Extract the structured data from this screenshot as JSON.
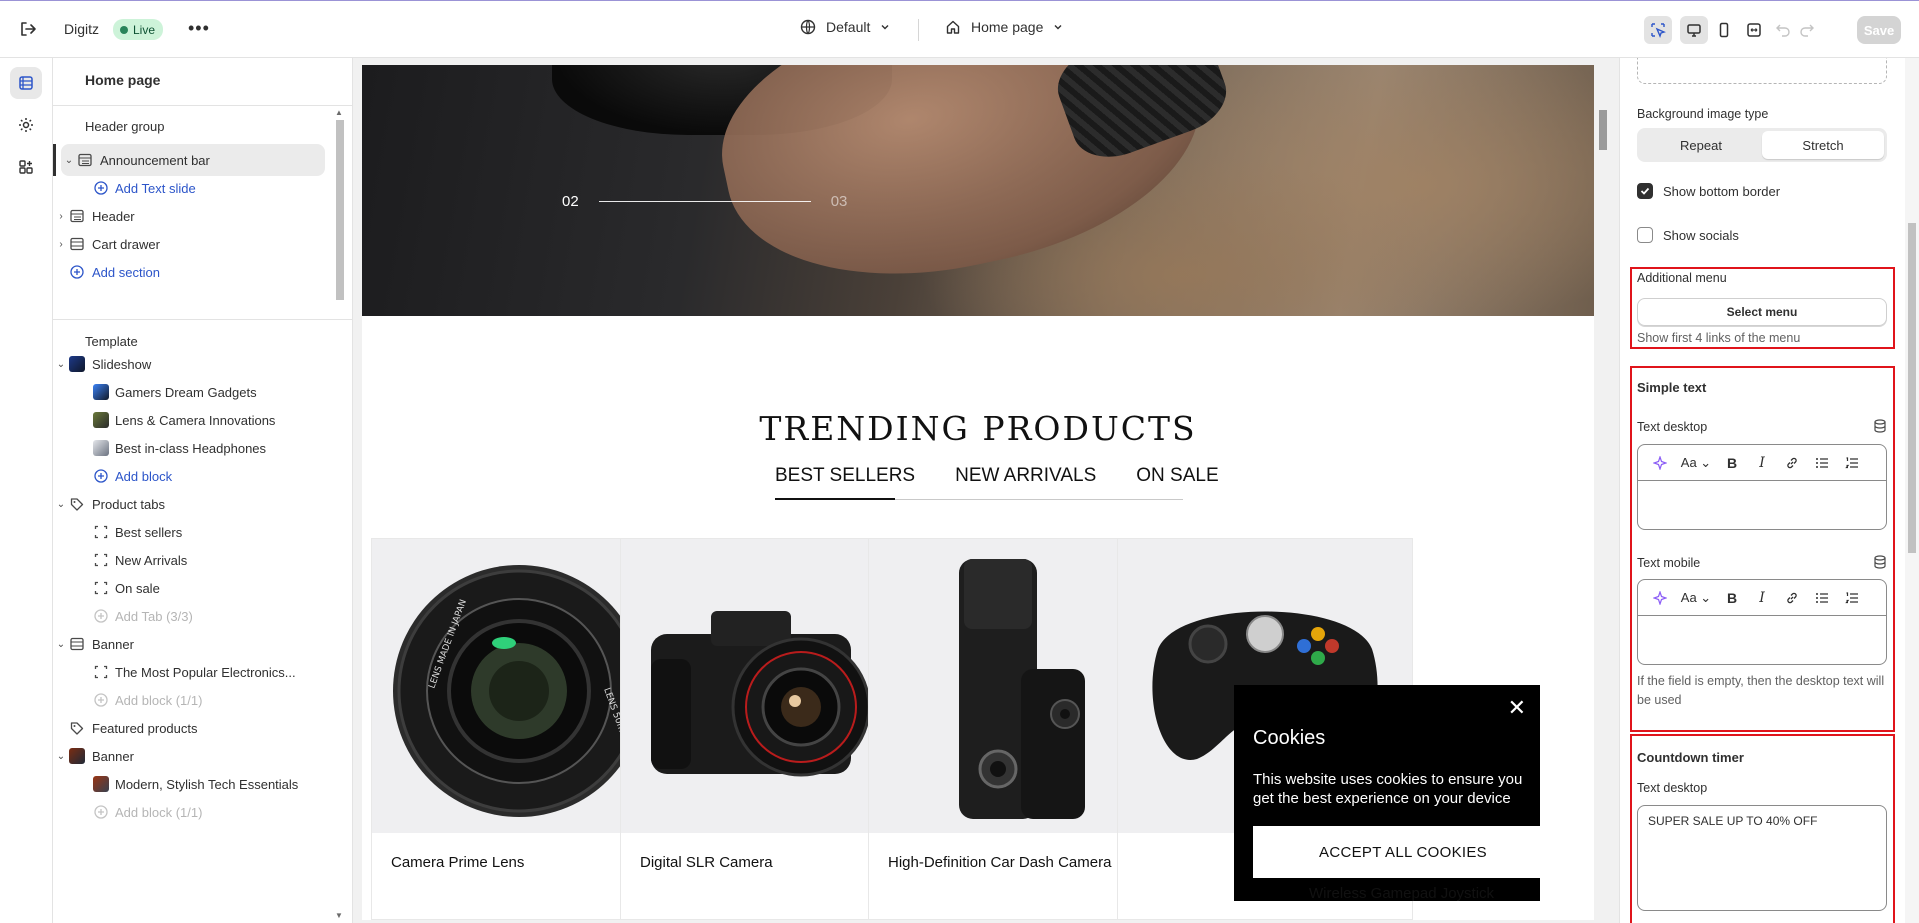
{
  "topbar": {
    "store_name": "Digitz",
    "status": "Live",
    "theme_select": "Default",
    "page_select": "Home page",
    "save_label": "Save"
  },
  "sidebar": {
    "title": "Home page",
    "header_group_label": "Header group",
    "header_items": [
      {
        "label": "Announcement bar",
        "icon": "section-icon",
        "selected": true
      },
      {
        "label": "Add Text slide",
        "type": "add"
      },
      {
        "label": "Header",
        "icon": "section-icon"
      },
      {
        "label": "Cart drawer",
        "icon": "section-icon"
      },
      {
        "label": "Add section",
        "type": "add"
      }
    ],
    "template_label": "Template",
    "template_items": [
      {
        "label": "Slideshow",
        "icon": "slideshow-thumb"
      },
      {
        "label": "Gamers Dream Gadgets",
        "icon": "image-thumb"
      },
      {
        "label": "Lens & Camera Innovations",
        "icon": "image-thumb"
      },
      {
        "label": "Best in-class Headphones",
        "icon": "image-thumb"
      },
      {
        "label": "Add block",
        "type": "add"
      },
      {
        "label": "Product tabs",
        "icon": "tag-icon"
      },
      {
        "label": "Best sellers",
        "icon": "block-icon"
      },
      {
        "label": "New Arrivals",
        "icon": "block-icon"
      },
      {
        "label": "On sale",
        "icon": "block-icon"
      },
      {
        "label": "Add Tab (3/3)",
        "type": "disabled"
      },
      {
        "label": "Banner",
        "icon": "section-icon"
      },
      {
        "label": "The Most Popular Electronics...",
        "icon": "block-icon"
      },
      {
        "label": "Add block (1/1)",
        "type": "disabled"
      },
      {
        "label": "Featured products",
        "icon": "tag-icon"
      },
      {
        "label": "Banner",
        "icon": "image-thumb"
      },
      {
        "label": "Modern, Stylish Tech Essentials",
        "icon": "image-thumb"
      },
      {
        "label": "Add block (1/1)",
        "type": "disabled"
      }
    ]
  },
  "preview": {
    "slide_current": "02",
    "slide_next": "03",
    "section_title": "TRENDING PRODUCTS",
    "tabs": [
      "BEST SELLERS",
      "NEW ARRIVALS",
      "ON SALE"
    ],
    "products": [
      {
        "name": "Camera Prime Lens"
      },
      {
        "name": "Digital SLR Camera"
      },
      {
        "name": "High-Definition Car Dash Camera"
      },
      {
        "name": "Wireless Gamepad Joystick"
      }
    ],
    "cookie": {
      "title": "Cookies",
      "text": "This website uses cookies to ensure you get the best experience on your device",
      "button": "ACCEPT ALL COOKIES"
    }
  },
  "settings": {
    "bg_image_type_label": "Background image type",
    "bg_image_type_options": [
      "Repeat",
      "Stretch"
    ],
    "bg_image_type_selected": "Stretch",
    "show_bottom_border": {
      "label": "Show bottom border",
      "checked": true
    },
    "show_socials": {
      "label": "Show socials",
      "checked": false
    },
    "additional_menu": {
      "label": "Additional menu",
      "button": "Select menu",
      "help": "Show first 4 links of the menu"
    },
    "simple_text": {
      "heading": "Simple text",
      "desktop_label": "Text desktop",
      "mobile_label": "Text mobile",
      "help": "If the field is empty, then the desktop text will be used"
    },
    "countdown": {
      "heading": "Countdown timer",
      "desktop_label": "Text desktop",
      "desktop_value": "SUPER SALE UP TO 40% OFF"
    }
  }
}
